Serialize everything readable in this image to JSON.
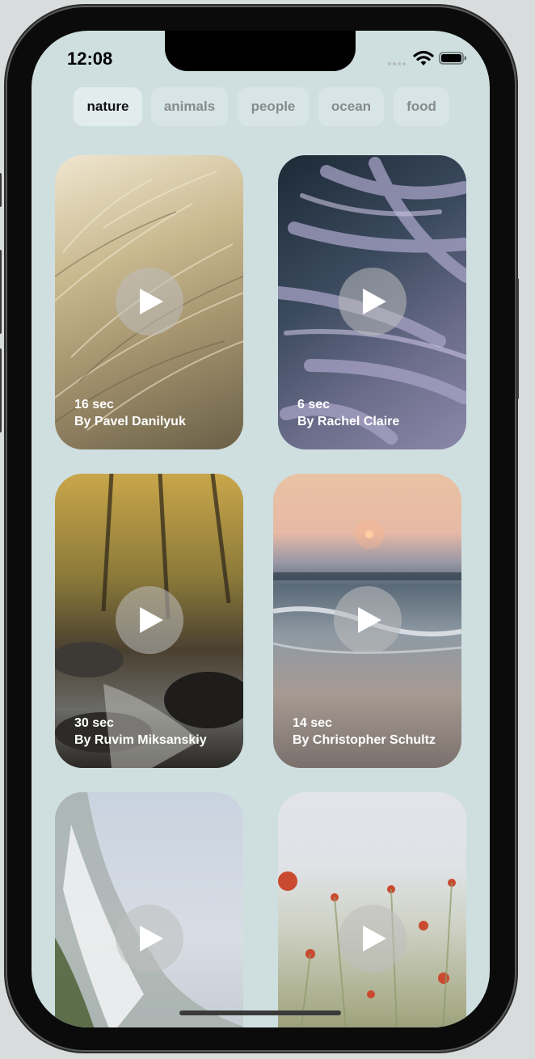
{
  "status_bar": {
    "time": "12:08",
    "signal_icon": "signal-icon",
    "wifi_icon": "wifi-icon",
    "battery_icon": "battery-icon"
  },
  "tabs": [
    {
      "label": "nature",
      "active": true
    },
    {
      "label": "animals",
      "active": false
    },
    {
      "label": "people",
      "active": false
    },
    {
      "label": "ocean",
      "active": false
    },
    {
      "label": "food",
      "active": false
    }
  ],
  "videos": [
    {
      "duration": "16 sec",
      "author": "By Pavel Danilyuk"
    },
    {
      "duration": "6 sec",
      "author": "By Rachel Claire"
    },
    {
      "duration": "30 sec",
      "author": "By Ruvim Miksanskiy"
    },
    {
      "duration": "14 sec",
      "author": "By Christopher Schultz"
    },
    {
      "duration": "",
      "author": ""
    },
    {
      "duration": "",
      "author": ""
    }
  ],
  "colors": {
    "background": "#cfdfe0",
    "tab_inactive": "#d7e5e6",
    "tab_active": "#e3ecec"
  }
}
